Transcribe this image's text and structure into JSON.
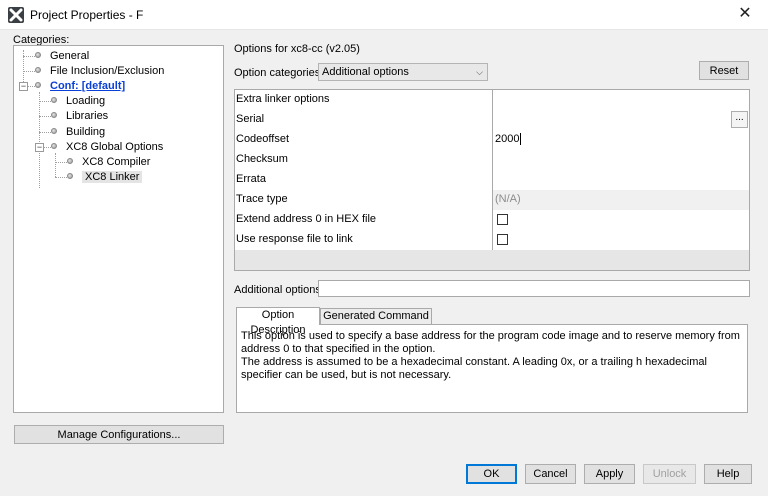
{
  "window": {
    "title": "Project Properties - F",
    "close_glyph": "✕",
    "icon": "x-logo-icon"
  },
  "categories": {
    "label": "Categories:",
    "items": [
      {
        "label": "General",
        "level": 1
      },
      {
        "label": "File Inclusion/Exclusion",
        "level": 1
      },
      {
        "label": "Conf: [default]",
        "level": 1,
        "expanded": true,
        "link": true
      },
      {
        "label": "Loading",
        "level": 2
      },
      {
        "label": "Libraries",
        "level": 2
      },
      {
        "label": "Building",
        "level": 2
      },
      {
        "label": "XC8 Global Options",
        "level": 2,
        "expanded": true
      },
      {
        "label": "XC8 Compiler",
        "level": 3
      },
      {
        "label": "XC8 Linker",
        "level": 3,
        "selected": true
      }
    ],
    "expander_glyph": "−"
  },
  "manage_button": "Manage Configurations...",
  "options": {
    "heading": "Options for xc8-cc (v2.05)",
    "category_label": "Option categories:",
    "category_value": "Additional options",
    "chevron": "⌵",
    "reset_label": "Reset",
    "rows": [
      {
        "name": "Extra linker options",
        "value": ""
      },
      {
        "name": "Serial",
        "value": "",
        "browse": "..."
      },
      {
        "name": "Codeoffset",
        "value": "2000"
      },
      {
        "name": "Checksum",
        "value": ""
      },
      {
        "name": "Errata",
        "value": ""
      },
      {
        "name": "Trace type",
        "value": "(N/A)",
        "disabled": true
      },
      {
        "name": "Extend address 0 in HEX file",
        "checkbox": true,
        "checked": false
      },
      {
        "name": "Use response file to link",
        "checkbox": true,
        "checked": false
      }
    ],
    "additional_label": "Additional options:",
    "additional_value": ""
  },
  "tabs": [
    {
      "label": "Option Description",
      "active": true
    },
    {
      "label": "Generated Command Line",
      "active": false
    }
  ],
  "description": {
    "line1": "This option is used to specify a base address for the program code image and to reserve memory from address 0 to that specified in the option.",
    "line2": "The address is assumed to be a hexadecimal constant. A leading 0x, or a trailing h hexadecimal specifier can be used, but is not necessary."
  },
  "buttons": {
    "ok": "OK",
    "cancel": "Cancel",
    "apply": "Apply",
    "unlock": "Unlock",
    "help": "Help"
  },
  "colors": {
    "link": "#0a3fd8",
    "ok_border": "#0078d7"
  }
}
